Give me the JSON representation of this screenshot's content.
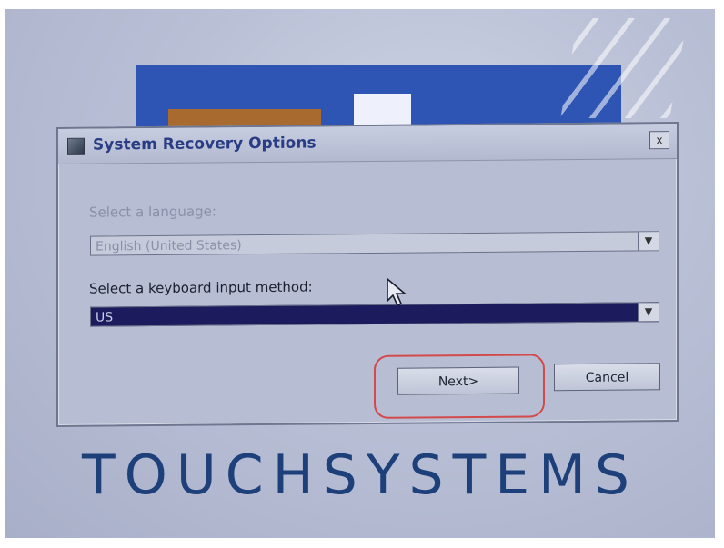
{
  "dialog": {
    "title": "System Recovery Options",
    "close_label": "x",
    "language_label": "Select a language:",
    "language_value": "English (United States)",
    "keyboard_label": "Select a keyboard input method:",
    "keyboard_value": "US",
    "next_label": "Next>",
    "cancel_label": "Cancel"
  },
  "background": {
    "brand_text": "TOUCHSYSTEMS"
  },
  "colors": {
    "highlight_ring": "#d24a4a",
    "selected_field": "#1b1b5e",
    "title_text": "#2a3d84"
  },
  "icons": [
    "window-icon",
    "close-icon",
    "dropdown-arrow-icon",
    "mouse-pointer-icon"
  ]
}
